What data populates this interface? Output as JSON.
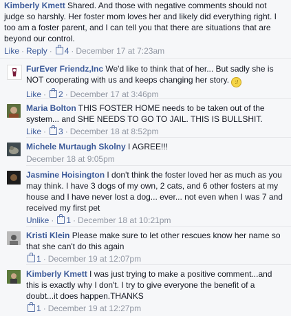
{
  "top_comment": {
    "author": "Kimberly Kmett",
    "text": "Shared. And those with negative comments should not judge so harshly. Her foster mom loves her and likely did everything right. I too am a foster parent, and I can tell you that there are situations that are beyond our control.",
    "like_label": "Like",
    "reply_label": "Reply",
    "like_count": "4",
    "time": "December 17 at 7:23am"
  },
  "replies": [
    {
      "author": "FurEver Friendz,Inc",
      "text": "We'd like to think that of her... But sadly she is NOT cooperating with us and keeps changing her story.",
      "emoji": "confused-face",
      "action_label": "Like",
      "like_count": "2",
      "time": "December 17 at 3:46pm"
    },
    {
      "author": "Maria Bolton",
      "text": "THIS FOSTER HOME needs to be taken out of the system... and SHE NEEDS TO GO TO JAIL. THIS IS BULLSHIT.",
      "action_label": "Like",
      "like_count": "3",
      "time": "December 18 at 8:52pm"
    },
    {
      "author": "Michele Murtaugh Skolny",
      "text": "I AGREE!!!",
      "time": "December 18 at 9:05pm"
    },
    {
      "author": "Jasmine Hoisington",
      "text": "I don't think the foster loved her as much as you may think. I have 3 dogs of my own, 2 cats, and 6 other fosters at my house and I have never lost a dog... ever... not even when I was 7 and received my first pet",
      "action_label": "Unlike",
      "like_count": "1",
      "time": "December 18 at 10:21pm"
    },
    {
      "author": "Kristi Klein",
      "text": "Please make sure to let other rescues know her name so that she can't do this again",
      "like_count": "1",
      "time": "December 19 at 12:07pm"
    },
    {
      "author": "Kimberly Kmett",
      "text": "I was just trying to make a positive comment...and this is exactly why I don't. I try to give everyone the benefit of a doubt...it does happen.THANKS",
      "like_count": "1",
      "time": "December 19 at 12:27pm"
    }
  ],
  "separator": "·"
}
